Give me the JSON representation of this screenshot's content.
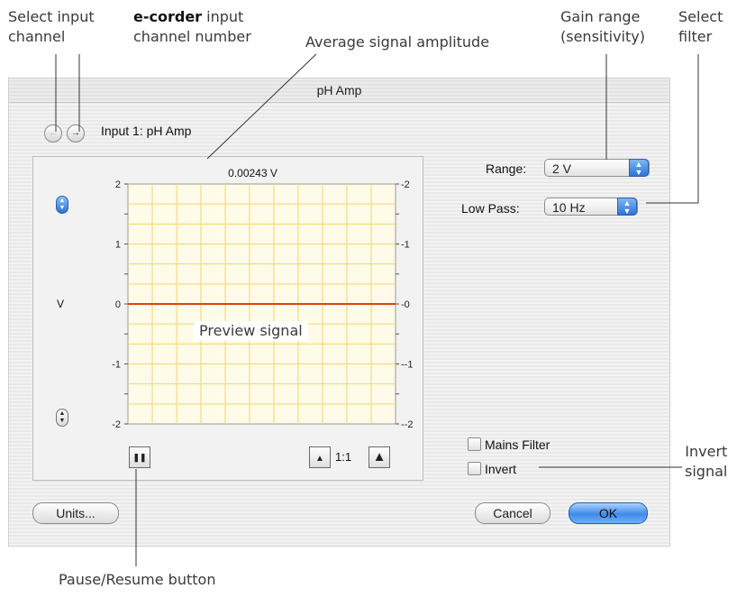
{
  "annotations": {
    "select_input_channel": [
      "Select input",
      "channel"
    ],
    "ecorder_brand": "e-corder",
    "ecorder_rest": " input",
    "ecorder_line2": "channel number",
    "average_signal": "Average signal amplitude",
    "gain_range": [
      "Gain range",
      "(sensitivity)"
    ],
    "select_filter": [
      "Select",
      "filter"
    ],
    "invert_signal": [
      "Invert",
      "signal"
    ],
    "pause_resume": "Pause/Resume button",
    "preview_signal": "Preview signal"
  },
  "window": {
    "title": "pH Amp",
    "input_label": "Input 1: pH Amp",
    "nav_prev_glyph": "←",
    "nav_next_glyph": "→"
  },
  "chart_data": {
    "type": "line",
    "title": "0.00243 V",
    "ylabel": "V",
    "ylim": [
      -2,
      2
    ],
    "yticks": [
      "2",
      "1",
      "0",
      "-1",
      "-2"
    ],
    "series": [
      {
        "values": [
          0,
          0
        ]
      }
    ],
    "grid": true,
    "line_color": "#d9440c",
    "grid_color": "#f3d56a"
  },
  "controls": {
    "range_label": "Range:",
    "range_value": "2 V",
    "lowpass_label": "Low Pass:",
    "lowpass_value": "10 Hz",
    "mains_filter_label": "Mains Filter",
    "invert_label": "Invert",
    "units_button": "Units...",
    "cancel_button": "Cancel",
    "ok_button": "OK",
    "scale_label": "1:1",
    "pause_glyph": "❚❚"
  },
  "colors": {
    "accent_blue": "#3f8ae6"
  }
}
